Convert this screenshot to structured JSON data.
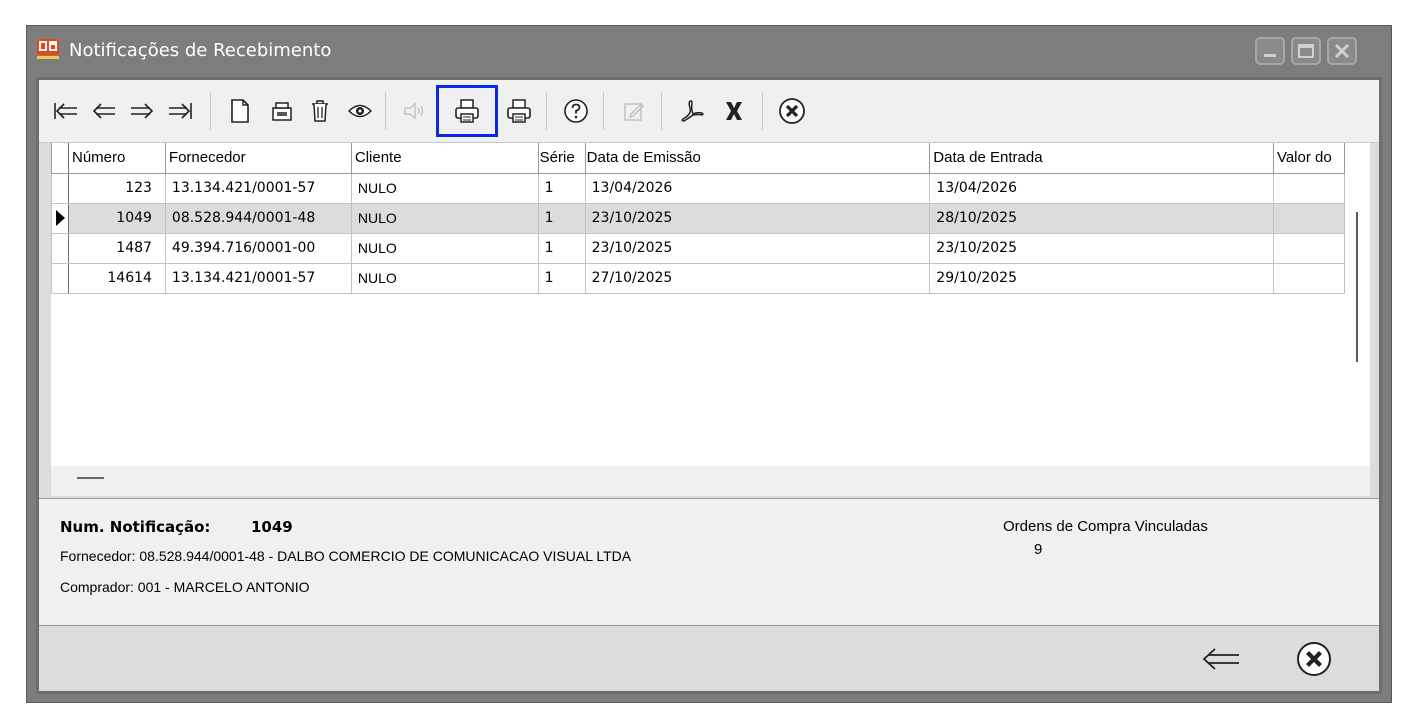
{
  "window": {
    "title": "Notificações de Recebimento",
    "controls": [
      "minimize-icon",
      "maximize-icon",
      "close-icon"
    ]
  },
  "toolbar": {
    "buttons": [
      {
        "name": "first-record",
        "icon": "first-arrow-icon",
        "enabled": true
      },
      {
        "name": "previous-record",
        "icon": "left-arrow-icon",
        "enabled": true
      },
      {
        "name": "next-record",
        "icon": "right-arrow-icon",
        "enabled": true
      },
      {
        "name": "last-record",
        "icon": "last-arrow-icon",
        "enabled": true
      },
      {
        "name": "new-document",
        "icon": "document-icon",
        "enabled": true
      },
      {
        "name": "cash-register",
        "icon": "register-icon",
        "enabled": true
      },
      {
        "name": "delete",
        "icon": "trash-icon",
        "enabled": true
      },
      {
        "name": "view",
        "icon": "eye-icon",
        "enabled": true
      },
      {
        "name": "notify-sound",
        "icon": "speaker-icon",
        "enabled": false
      },
      {
        "name": "print-selected",
        "icon": "printer-icon",
        "enabled": true,
        "selected": true
      },
      {
        "name": "print",
        "icon": "printer-icon",
        "enabled": true
      },
      {
        "name": "help",
        "icon": "help-icon",
        "enabled": true
      },
      {
        "name": "edit",
        "icon": "edit-icon",
        "enabled": false
      },
      {
        "name": "export-pdf",
        "icon": "pdf-icon",
        "enabled": true
      },
      {
        "name": "export-excel",
        "icon": "excel-icon",
        "enabled": true
      },
      {
        "name": "close",
        "icon": "close-circle-icon",
        "enabled": true
      }
    ]
  },
  "grid": {
    "columns": [
      "Número",
      "Fornecedor",
      "Cliente",
      "Série",
      "Data de Emissão",
      "Data de Entrada",
      "Valor do"
    ],
    "rows": [
      {
        "numero": "123",
        "fornecedor": "13.134.421/0001-57",
        "cliente": "NULO",
        "serie": "1",
        "emissao": "13/04/2026",
        "entrada": "13/04/2026",
        "valor": ""
      },
      {
        "numero": "1049",
        "fornecedor": "08.528.944/0001-48",
        "cliente": "NULO",
        "serie": "1",
        "emissao": "23/10/2025",
        "entrada": "28/10/2025",
        "valor": "",
        "selected": true
      },
      {
        "numero": "1487",
        "fornecedor": "49.394.716/0001-00",
        "cliente": "NULO",
        "serie": "1",
        "emissao": "23/10/2025",
        "entrada": "23/10/2025",
        "valor": ""
      },
      {
        "numero": "14614",
        "fornecedor": "13.134.421/0001-57",
        "cliente": "NULO",
        "serie": "1",
        "emissao": "27/10/2025",
        "entrada": "29/10/2025",
        "valor": ""
      }
    ]
  },
  "details": {
    "num_label": "Num. Notificação:",
    "num_value": "1049",
    "fornecedor_line": "Fornecedor: 08.528.944/0001-48 - DALBO COMERCIO DE COMUNICACAO VISUAL LTDA",
    "comprador_line": "Comprador: 001 - MARCELO ANTONIO",
    "ordens_label": "Ordens de Compra Vinculadas",
    "ordens_value": "9"
  },
  "footer": {
    "buttons": [
      {
        "name": "back",
        "icon": "back-arrow-icon"
      },
      {
        "name": "close",
        "icon": "close-circle-icon"
      }
    ]
  }
}
